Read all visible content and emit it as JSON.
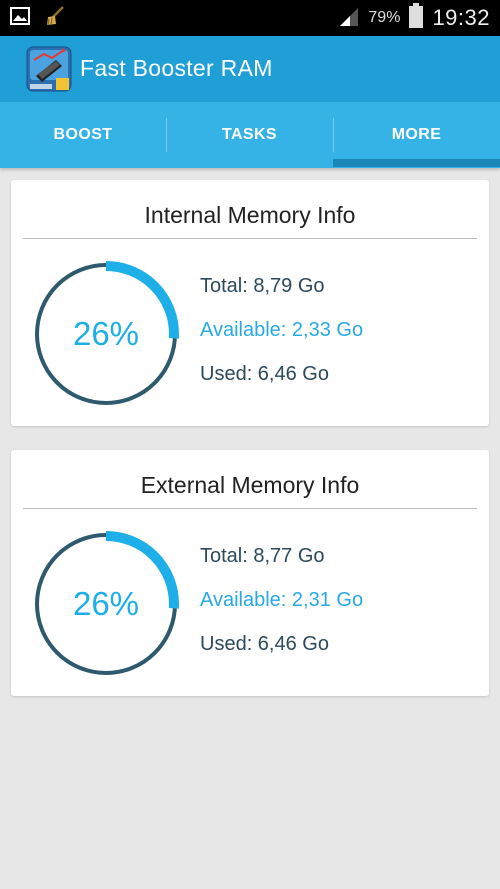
{
  "status_bar": {
    "battery_percent": "79%",
    "time": "19:32"
  },
  "app": {
    "title": "Fast Booster RAM"
  },
  "tabs": [
    {
      "label": "BOOST",
      "active": false
    },
    {
      "label": "TASKS",
      "active": false
    },
    {
      "label": "MORE",
      "active": true
    }
  ],
  "colors": {
    "app_bar": "#1f9fd6",
    "tab_bar": "#35b2e6",
    "ring_track": "#2f5a6e",
    "ring_progress": "#1eaee8"
  },
  "cards": [
    {
      "title": "Internal Memory Info",
      "percent_text": "26%",
      "fill_fraction": 0.26,
      "total": "Total: 8,79 Go",
      "available": "Available: 2,33 Go",
      "used": "Used: 6,46 Go"
    },
    {
      "title": "External Memory Info",
      "percent_text": "26%",
      "fill_fraction": 0.26,
      "total": "Total: 8,77 Go",
      "available": "Available: 2,31 Go",
      "used": "Used: 6,46 Go"
    }
  ]
}
